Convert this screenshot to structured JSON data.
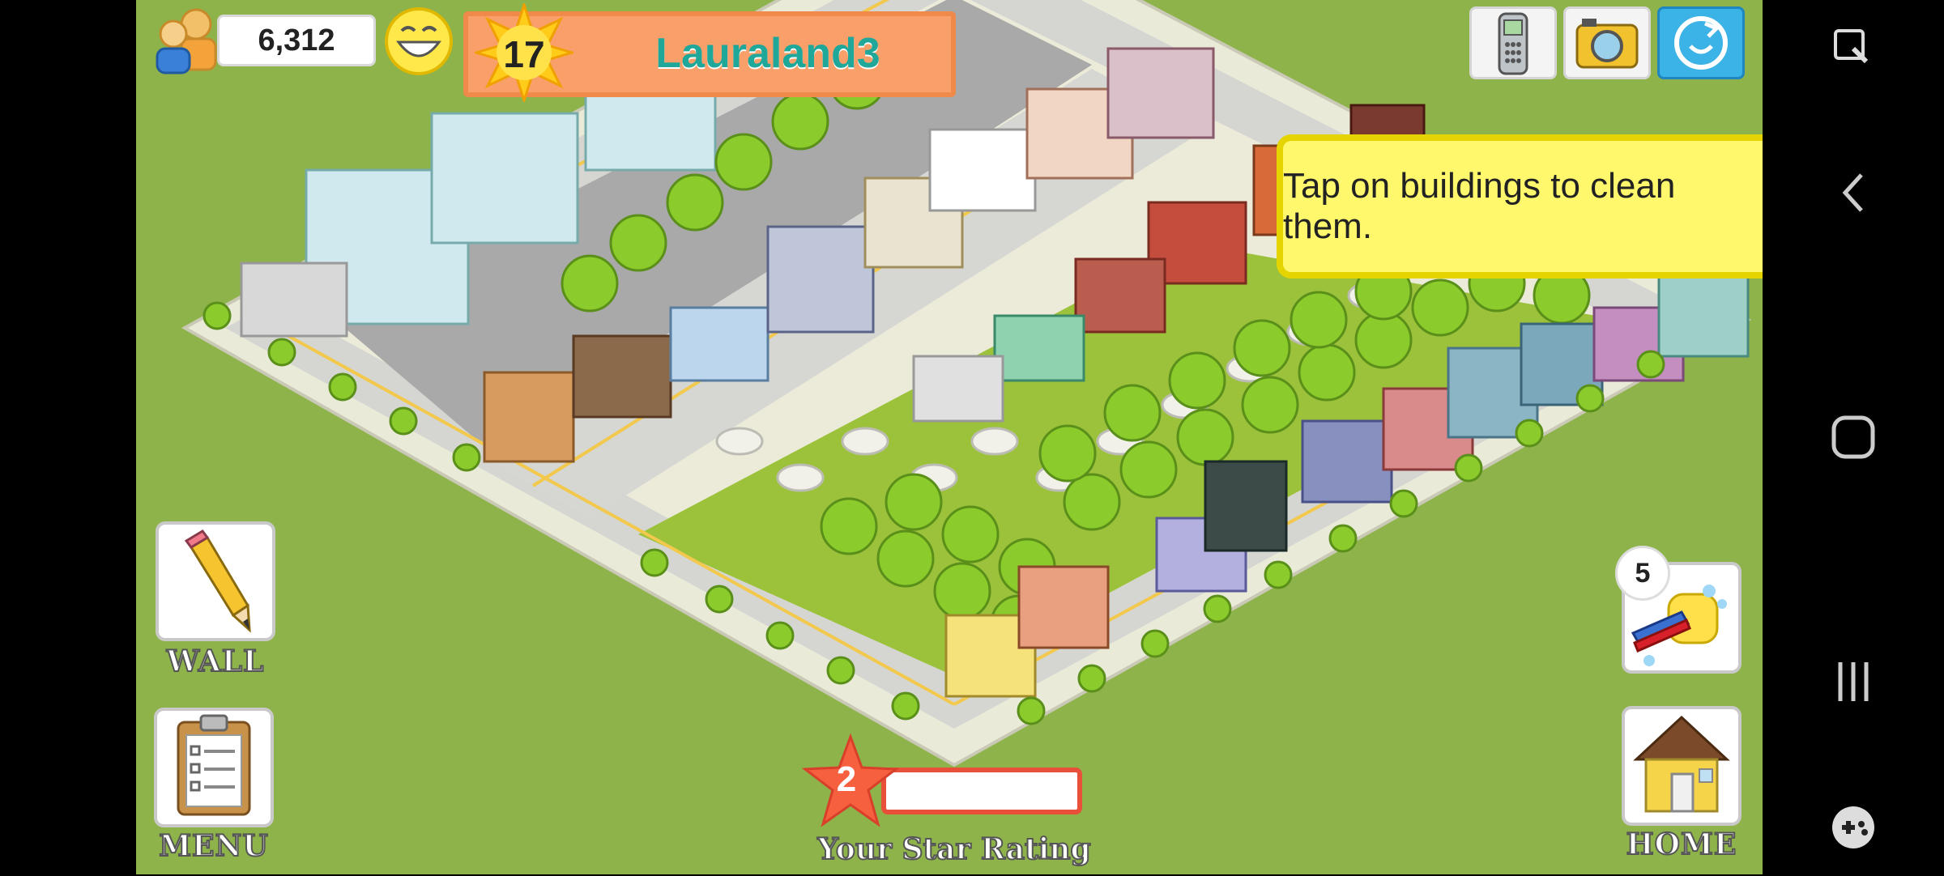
{
  "hud": {
    "population": "6,312",
    "level": "17",
    "town_name": "Lauraland3"
  },
  "tooltip": {
    "text": "Tap on buildings to clean them."
  },
  "buttons": {
    "wall_label": "WALL",
    "menu_label": "MENU",
    "home_label": "HOME"
  },
  "cleaning": {
    "count": "5"
  },
  "star_rating": {
    "value": "2",
    "label": "Your Star Rating",
    "progress": 0.0
  },
  "icons": {
    "population": "population-icon",
    "mood": "smiley-icon",
    "level": "sun-star-icon",
    "phone": "phone-icon",
    "camera": "camera-icon",
    "share": "share-icon",
    "wall": "pencil-icon",
    "menu": "clipboard-icon",
    "clean": "squeegee-icon",
    "home": "house-icon"
  },
  "colors": {
    "grass": "#8db34a",
    "level_bar": "#f9a06a",
    "town_name": "#1fa89a",
    "tooltip_bg": "#fff86c",
    "rating_border": "#e8503a"
  }
}
